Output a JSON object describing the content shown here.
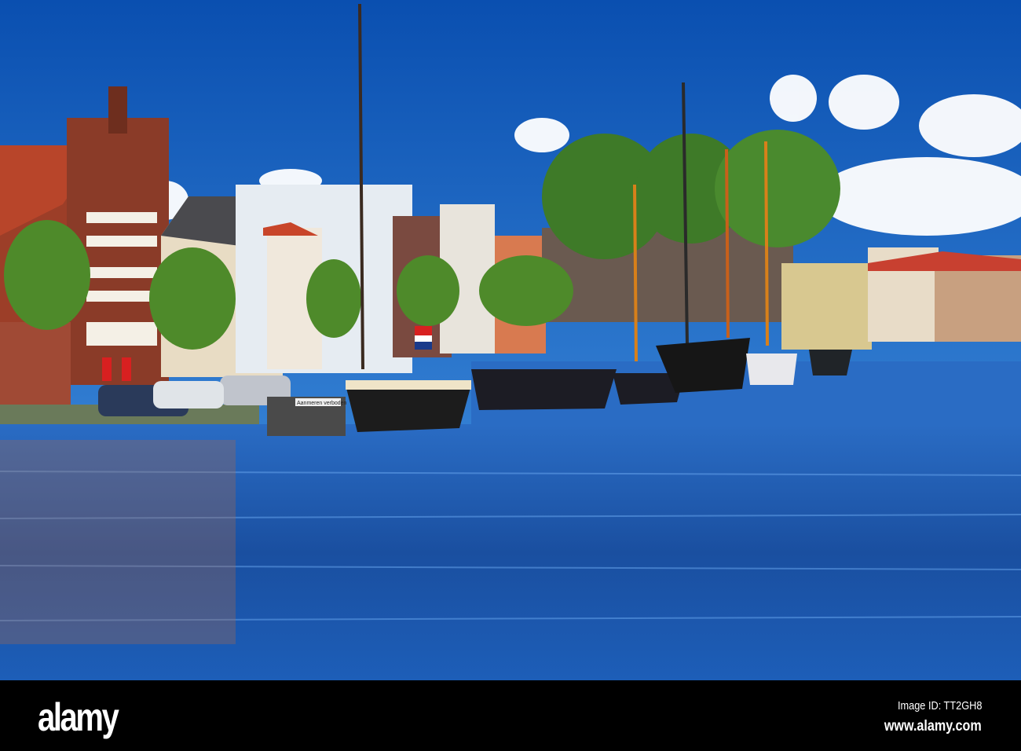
{
  "photo": {
    "subject": "canal harbour with moored boats",
    "sign_text": "Aanmeren verboden"
  },
  "footer": {
    "logo": "alamy",
    "image_id": "Image ID: TT2GH8",
    "url": "www.alamy.com"
  },
  "colors": {
    "sky_top": "#0a4fb0",
    "sky_low": "#3d8fe0",
    "water": "#1c55a8",
    "brick": "#8a3b28",
    "roof": "#b8452a"
  }
}
